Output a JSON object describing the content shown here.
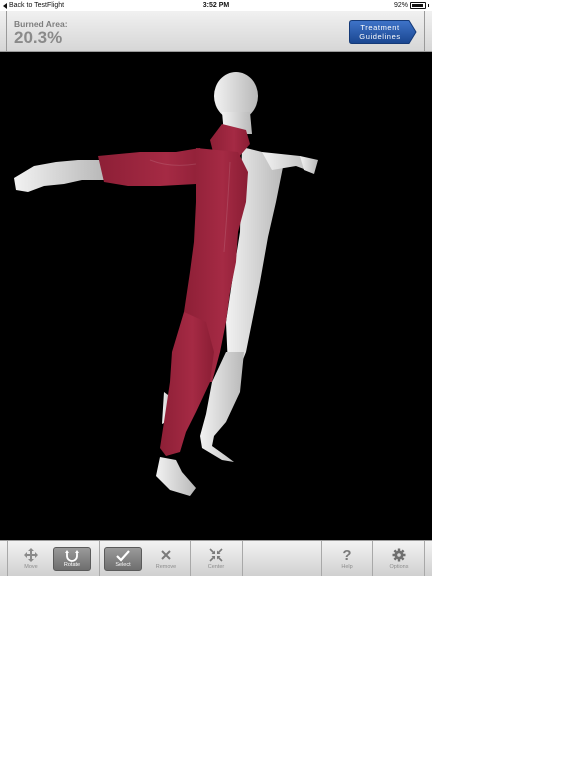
{
  "status_bar": {
    "back_label": "Back to TestFlight",
    "time": "3:52 PM",
    "battery": "92%",
    "battery_level": 0.92
  },
  "header": {
    "burned_label": "Burned Area:",
    "burned_value": "20.3%",
    "treatment_line1": "Treatment",
    "treatment_line2": "Guidelines"
  },
  "viewport": {
    "model": "3d-human-body-burn-map",
    "burn_color": "#a0263f",
    "skin_color": "#d9d9d9"
  },
  "toolbar": {
    "move": {
      "label": "Move",
      "icon": "move-icon"
    },
    "rotate": {
      "label": "Rotate",
      "icon": "rotate-icon",
      "active": true
    },
    "select": {
      "label": "Select",
      "icon": "check-icon",
      "active": true
    },
    "remove": {
      "label": "Remove",
      "icon": "x-icon"
    },
    "center": {
      "label": "Center",
      "icon": "center-icon"
    },
    "help": {
      "label": "Help",
      "icon": "question-icon"
    },
    "options": {
      "label": "Options",
      "icon": "gear-icon"
    }
  },
  "colors": {
    "accent_blue": "#1d4e9e",
    "burn": "#a0263f"
  }
}
